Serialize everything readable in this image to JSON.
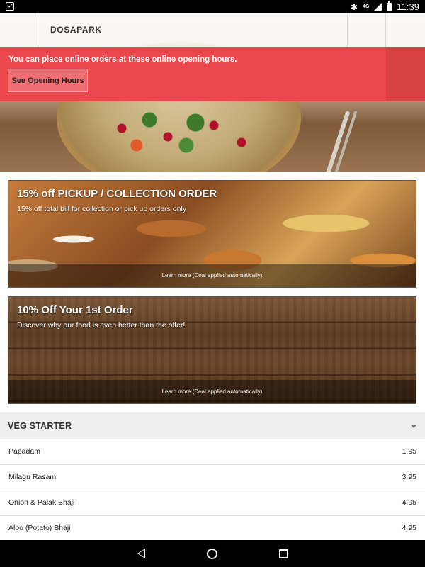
{
  "status_bar": {
    "time": "11:39",
    "network": "4G",
    "icons": [
      "checklist-icon",
      "bluetooth-icon",
      "signal-icon",
      "battery-icon"
    ]
  },
  "app_bar": {
    "title": "DOSAPARK"
  },
  "notice": {
    "text": "You can place online orders at these online opening hours.",
    "button_label": "See Opening Hours",
    "color": "#e9474b"
  },
  "deals": [
    {
      "title": "15% off PICKUP / COLLECTION ORDER",
      "subtitle": "15% off total bill for collection or pick up orders only",
      "footer": "Learn more (Deal applied automatically)"
    },
    {
      "title": "10% Off Your 1st Order",
      "subtitle": "Discover why our food is even better than the offer!",
      "footer": "Learn more (Deal applied automatically)"
    }
  ],
  "menu": {
    "section_title": "VEG STARTER",
    "items": [
      {
        "name": "Papadam",
        "price": "1.95"
      },
      {
        "name": "Milagu Rasam",
        "price": "3.95"
      },
      {
        "name": "Onion & Palak Bhaji",
        "price": "4.95"
      },
      {
        "name": "Aloo (Potato) Bhaji",
        "price": "4.95"
      }
    ]
  },
  "nav_bar": {
    "icons": [
      "back-icon",
      "home-icon",
      "recents-icon"
    ]
  }
}
